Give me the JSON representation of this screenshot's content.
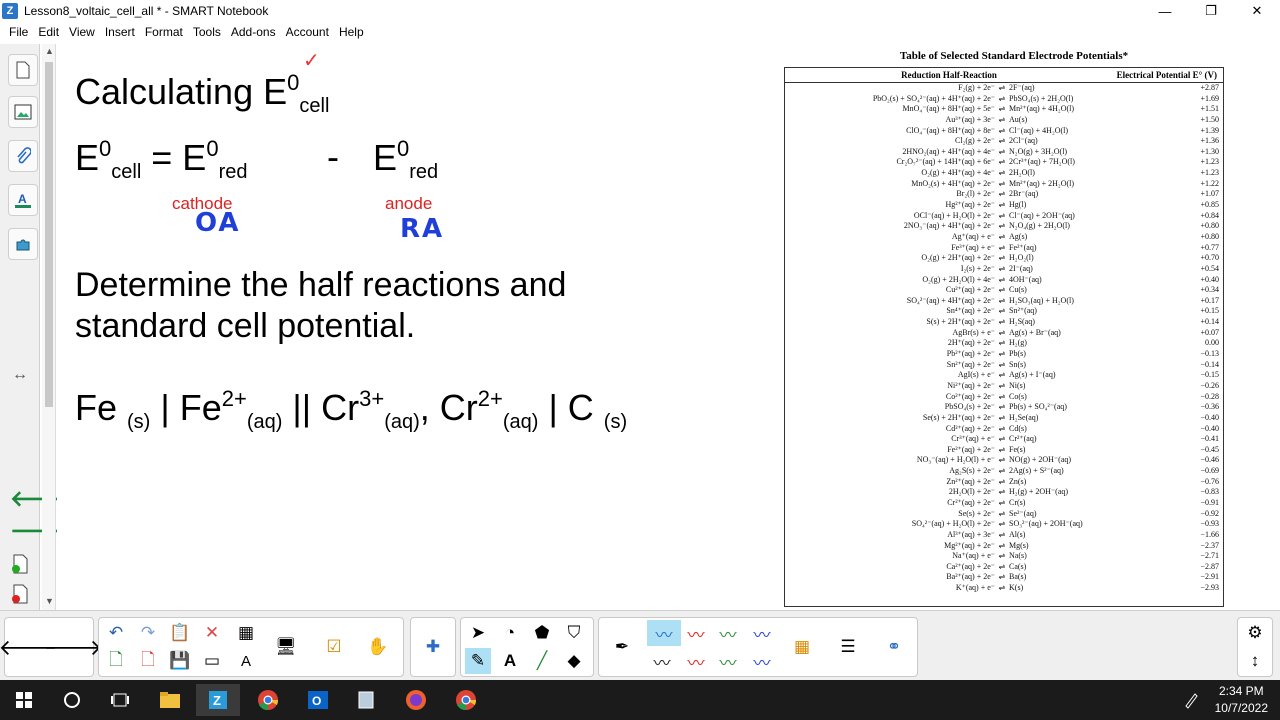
{
  "window": {
    "title": "Lesson8_voltaic_cell_all * - SMART Notebook",
    "minimize": "—",
    "maximize": "❐",
    "close": "✕"
  },
  "menu": [
    "File",
    "Edit",
    "View",
    "Insert",
    "Format",
    "Tools",
    "Add-ons",
    "Account",
    "Help"
  ],
  "slide": {
    "heading_text": "Calculating E",
    "heading_sup": "0",
    "heading_sub": "cell",
    "eq_e1": "E",
    "eq_sup1": "0",
    "eq_sub1": "cell",
    "eq_equals": " = E",
    "eq_sup2": "0",
    "eq_sub2": "red",
    "eq_minus": "-",
    "eq_e3": "E",
    "eq_sup3": "0",
    "eq_sub3": "red",
    "cathode_label": "cathode",
    "anode_label": "anode",
    "cathode_ink": "OA",
    "anode_ink": "RA",
    "prompt_line1": "Determine the half reactions and",
    "prompt_line2": "standard cell potential.",
    "cell": {
      "p1": "Fe ",
      "s1": "(s)",
      "p2": " | Fe",
      "sup2": "2+",
      "s2": "(aq)",
      "p3": " || Cr",
      "sup3": "3+",
      "s3": "(aq)",
      "p4": ", Cr",
      "sup4": "2+",
      "s4": "(aq)",
      "p5": " | C ",
      "s5": "(s)"
    }
  },
  "table": {
    "title": "Table of Selected Standard Electrode Potentials*",
    "col1": "Reduction Half-Reaction",
    "col2": "Electrical Potential E° (V)",
    "rows": [
      [
        "F₂(g) + 2e⁻",
        "2F⁻(aq)",
        "+2.87"
      ],
      [
        "PbO₂(s) + SO₄²⁻(aq) + 4H⁺(aq) + 2e⁻",
        "PbSO₄(s) + 2H₂O(l)",
        "+1.69"
      ],
      [
        "MnO₄⁻(aq) + 8H⁺(aq) + 5e⁻",
        "Mn²⁺(aq) + 4H₂O(l)",
        "+1.51"
      ],
      [
        "Au³⁺(aq) + 3e⁻",
        "Au(s)",
        "+1.50"
      ],
      [
        "ClO₄⁻(aq) + 8H⁺(aq) + 8e⁻",
        "Cl⁻(aq) + 4H₂O(l)",
        "+1.39"
      ],
      [
        "Cl₂(g) + 2e⁻",
        "2Cl⁻(aq)",
        "+1.36"
      ],
      [
        "2HNO₂(aq) + 4H⁺(aq) + 4e⁻",
        "N₂O(g) + 3H₂O(l)",
        "+1.30"
      ],
      [
        "Cr₂O₇²⁻(aq) + 14H⁺(aq) + 6e⁻",
        "2Cr³⁺(aq) + 7H₂O(l)",
        "+1.23"
      ],
      [
        "O₂(g) + 4H⁺(aq) + 4e⁻",
        "2H₂O(l)",
        "+1.23"
      ],
      [
        "MnO₂(s) + 4H⁺(aq) + 2e⁻",
        "Mn²⁺(aq) + 2H₂O(l)",
        "+1.22"
      ],
      [
        "Br₂(l) + 2e⁻",
        "2Br⁻(aq)",
        "+1.07"
      ],
      [
        "Hg²⁺(aq) + 2e⁻",
        "Hg(l)",
        "+0.85"
      ],
      [
        "OCl⁻(aq) + H₂O(l) + 2e⁻",
        "Cl⁻(aq) + 2OH⁻(aq)",
        "+0.84"
      ],
      [
        "2NO₃⁻(aq) + 4H⁺(aq) + 2e⁻",
        "N₂O₄(g) + 2H₂O(l)",
        "+0.80"
      ],
      [
        "Ag⁺(aq) + e⁻",
        "Ag(s)",
        "+0.80"
      ],
      [
        "Fe³⁺(aq) + e⁻",
        "Fe²⁺(aq)",
        "+0.77"
      ],
      [
        "O₂(g) + 2H⁺(aq) + 2e⁻",
        "H₂O₂(l)",
        "+0.70"
      ],
      [
        "I₂(s) + 2e⁻",
        "2I⁻(aq)",
        "+0.54"
      ],
      [
        "O₂(g) + 2H₂O(l) + 4e⁻",
        "4OH⁻(aq)",
        "+0.40"
      ],
      [
        "Cu²⁺(aq) + 2e⁻",
        "Cu(s)",
        "+0.34"
      ],
      [
        "SO₄²⁻(aq) + 4H⁺(aq) + 2e⁻",
        "H₂SO₃(aq) + H₂O(l)",
        "+0.17"
      ],
      [
        "Sn⁴⁺(aq) + 2e⁻",
        "Sn²⁺(aq)",
        "+0.15"
      ],
      [
        "S(s) + 2H⁺(aq) + 2e⁻",
        "H₂S(aq)",
        "+0.14"
      ],
      [
        "AgBr(s) + e⁻",
        "Ag(s) + Br⁻(aq)",
        "+0.07"
      ],
      [
        "2H⁺(aq) + 2e⁻",
        "H₂(g)",
        "0.00"
      ],
      [
        "Pb²⁺(aq) + 2e⁻",
        "Pb(s)",
        "−0.13"
      ],
      [
        "Sn²⁺(aq) + 2e⁻",
        "Sn(s)",
        "−0.14"
      ],
      [
        "AgI(s) + e⁻",
        "Ag(s) + I⁻(aq)",
        "−0.15"
      ],
      [
        "Ni²⁺(aq) + 2e⁻",
        "Ni(s)",
        "−0.26"
      ],
      [
        "Co²⁺(aq) + 2e⁻",
        "Co(s)",
        "−0.28"
      ],
      [
        "PbSO₄(s) + 2e⁻",
        "Pb(s) + SO₄²⁻(aq)",
        "−0.36"
      ],
      [
        "Se(s) + 2H⁺(aq) + 2e⁻",
        "H₂Se(aq)",
        "−0.40"
      ],
      [
        "Cd²⁺(aq) + 2e⁻",
        "Cd(s)",
        "−0.40"
      ],
      [
        "Cr³⁺(aq) + e⁻",
        "Cr²⁺(aq)",
        "−0.41"
      ],
      [
        "Fe²⁺(aq) + 2e⁻",
        "Fe(s)",
        "−0.45"
      ],
      [
        "NO₃⁻(aq) + H₂O(l) + e⁻",
        "NO(g) + 2OH⁻(aq)",
        "−0.46"
      ],
      [
        "Ag₂S(s) + 2e⁻",
        "2Ag(s) + S²⁻(aq)",
        "−0.69"
      ],
      [
        "Zn²⁺(aq) + 2e⁻",
        "Zn(s)",
        "−0.76"
      ],
      [
        "2H₂O(l) + 2e⁻",
        "H₂(g) + 2OH⁻(aq)",
        "−0.83"
      ],
      [
        "Cr²⁺(aq) + 2e⁻",
        "Cr(s)",
        "−0.91"
      ],
      [
        "Se(s) + 2e⁻",
        "Se²⁻(aq)",
        "−0.92"
      ],
      [
        "SO₄²⁻(aq) + H₂O(l) + 2e⁻",
        "SO₃²⁻(aq) + 2OH⁻(aq)",
        "−0.93"
      ],
      [
        "Al³⁺(aq) + 3e⁻",
        "Al(s)",
        "−1.66"
      ],
      [
        "Mg²⁺(aq) + 2e⁻",
        "Mg(s)",
        "−2.37"
      ],
      [
        "Na⁺(aq) + e⁻",
        "Na(s)",
        "−2.71"
      ],
      [
        "Ca²⁺(aq) + 2e⁻",
        "Ca(s)",
        "−2.87"
      ],
      [
        "Ba²⁺(aq) + 2e⁻",
        "Ba(s)",
        "−2.91"
      ],
      [
        "K⁺(aq) + e⁻",
        "K(s)",
        "−2.93"
      ]
    ]
  },
  "taskbar": {
    "time": "2:34 PM",
    "date": "10/7/2022"
  },
  "colors": {
    "ink_red": "#d22222",
    "ink_blue": "#1f3fd8",
    "taskbar": "#1b1b1b"
  }
}
